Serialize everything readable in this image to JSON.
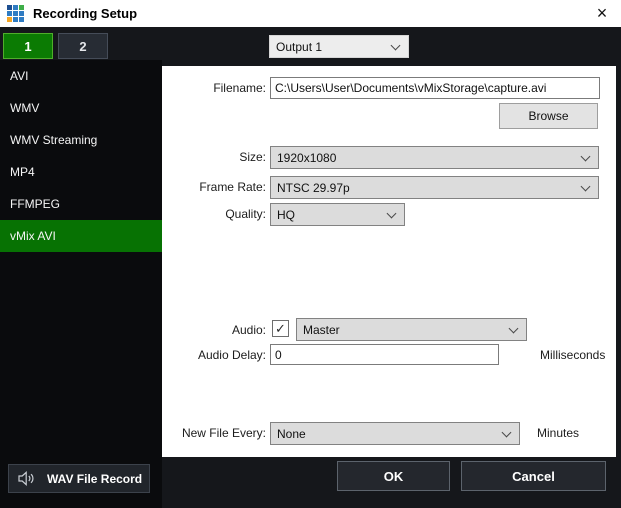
{
  "window": {
    "title": "Recording Setup"
  },
  "icons": {
    "close": "×",
    "check": "✓"
  },
  "brand_icon": {
    "cells": [
      "#1d4f91",
      "#2f7cc3",
      "#3fae49",
      "#2f7cc3",
      "#2f7cc3",
      "#2f7cc3",
      "#f5a623",
      "#2f7cc3",
      "#2f7cc3"
    ]
  },
  "tabs": [
    {
      "label": "1"
    },
    {
      "label": "2"
    }
  ],
  "output_select": {
    "value": "Output 1"
  },
  "sidebar": {
    "items": [
      {
        "label": "AVI"
      },
      {
        "label": "WMV"
      },
      {
        "label": "WMV Streaming"
      },
      {
        "label": "MP4"
      },
      {
        "label": "FFMPEG"
      },
      {
        "label": "vMix AVI"
      }
    ],
    "selected": "vMix AVI"
  },
  "form": {
    "filename": {
      "label": "Filename:",
      "value": "C:\\Users\\User\\Documents\\vMixStorage\\capture.avi"
    },
    "browse": {
      "label": "Browse"
    },
    "size": {
      "label": "Size:",
      "value": "1920x1080"
    },
    "frame_rate": {
      "label": "Frame Rate:",
      "value": "NTSC 29.97p"
    },
    "quality": {
      "label": "Quality:",
      "value": "HQ"
    },
    "audio": {
      "label": "Audio:",
      "checked": true,
      "value": "Master"
    },
    "audio_delay": {
      "label": "Audio Delay:",
      "value": "0",
      "unit": "Milliseconds"
    },
    "new_file_every": {
      "label": "New File Every:",
      "value": "None",
      "unit": "Minutes"
    }
  },
  "footer": {
    "wav_record": "WAV File Record",
    "ok": "OK",
    "cancel": "Cancel"
  },
  "colors": {
    "accent_green": "#0b7b03",
    "selected_green": "#077203",
    "panel": "#ffffff"
  }
}
